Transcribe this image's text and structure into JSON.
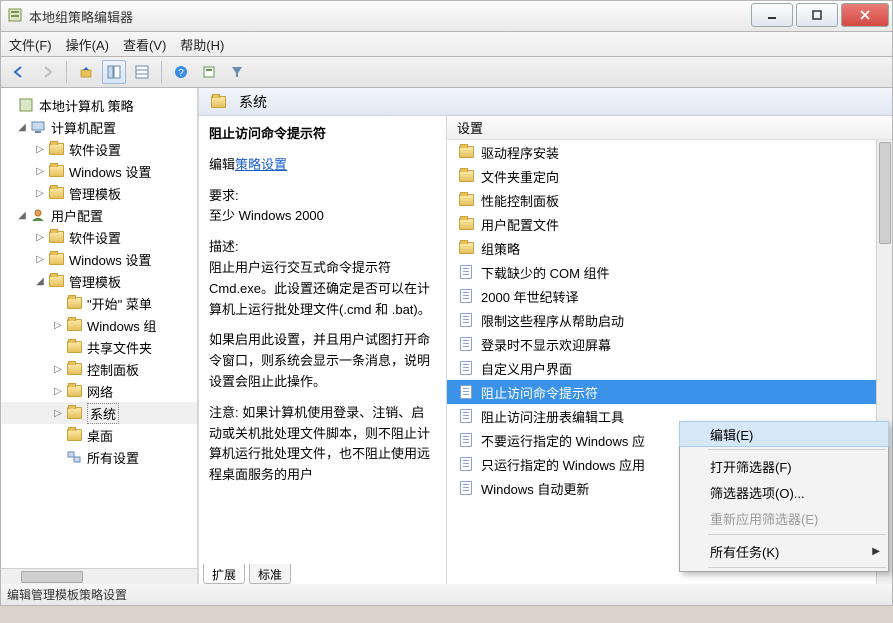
{
  "title": "本地组策略编辑器",
  "menubar": [
    "文件(F)",
    "操作(A)",
    "查看(V)",
    "帮助(H)"
  ],
  "tree": {
    "root": "本地计算机 策略",
    "computer_cfg": "计算机配置",
    "c_soft": "软件设置",
    "c_win": "Windows 设置",
    "c_admin": "管理模板",
    "user_cfg": "用户配置",
    "u_soft": "软件设置",
    "u_win": "Windows 设置",
    "u_admin": "管理模板",
    "u_start": "\"开始\" 菜单",
    "u_wincomp": "Windows 组",
    "u_share": "共享文件夹",
    "u_cpl": "控制面板",
    "u_net": "网络",
    "u_sys": "系统",
    "u_desk": "桌面",
    "u_all": "所有设置"
  },
  "right_header": "系统",
  "desc": {
    "title": "阻止访问命令提示符",
    "edit_label": "编辑",
    "policy_link": "策略设置",
    "req_label": "要求:",
    "req_text": "至少 Windows 2000",
    "desc_label": "描述:",
    "desc_text1": "阻止用户运行交互式命令提示符 Cmd.exe。此设置还确定是否可以在计算机上运行批处理文件(.cmd 和 .bat)。",
    "desc_text2": "如果启用此设置，并且用户试图打开命令窗口，则系统会显示一条消息，说明设置会阻止此操作。",
    "desc_text3": "注意: 如果计算机使用登录、注销、启动或关机批处理文件脚本，则不阻止计算机运行批处理文件，也不阻止使用远程桌面服务的用户"
  },
  "settings_header": "设置",
  "settings": [
    {
      "type": "folder",
      "label": "驱动程序安装"
    },
    {
      "type": "folder",
      "label": "文件夹重定向"
    },
    {
      "type": "folder",
      "label": "性能控制面板"
    },
    {
      "type": "folder",
      "label": "用户配置文件"
    },
    {
      "type": "folder",
      "label": "组策略"
    },
    {
      "type": "doc",
      "label": "下载缺少的 COM 组件"
    },
    {
      "type": "doc",
      "label": "2000 年世纪转译"
    },
    {
      "type": "doc",
      "label": "限制这些程序从帮助启动"
    },
    {
      "type": "doc",
      "label": "登录时不显示欢迎屏幕"
    },
    {
      "type": "doc",
      "label": "自定义用户界面"
    },
    {
      "type": "doc",
      "label": "阻止访问命令提示符",
      "selected": true
    },
    {
      "type": "doc",
      "label": "阻止访问注册表编辑工具"
    },
    {
      "type": "doc",
      "label": "不要运行指定的 Windows 应"
    },
    {
      "type": "doc",
      "label": "只运行指定的 Windows 应用"
    },
    {
      "type": "doc",
      "label": "Windows 自动更新"
    }
  ],
  "tabs": {
    "extended": "扩展",
    "standard": "标准"
  },
  "statusbar": "编辑管理模板策略设置",
  "context_menu": {
    "edit": "编辑(E)",
    "filter_open": "打开筛选器(F)",
    "filter_opts": "筛选器选项(O)...",
    "filter_reapply": "重新应用筛选器(E)",
    "all_tasks": "所有任务(K)"
  }
}
